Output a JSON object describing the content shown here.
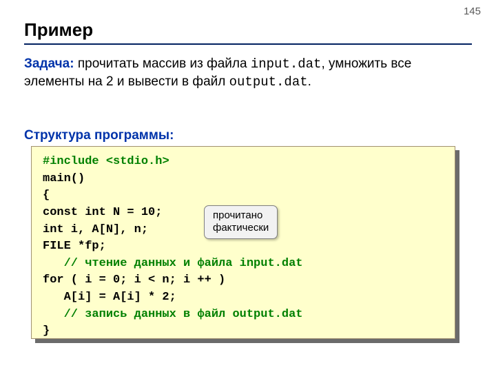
{
  "page_number": "145",
  "title": "Пример",
  "task": {
    "label": "Задача:",
    "text_before_file1": " прочитать массив из файла ",
    "file1": "input.dat",
    "text_mid": ", умножить все элементы на 2 и вывести в файл ",
    "file2": "output.dat",
    "text_after": "."
  },
  "struct_label": "Структура программы:",
  "code": {
    "l1a": "#include ",
    "l1b": "<stdio.h>",
    "l2": "main()",
    "l3": "{",
    "l4": "const int N = 10;",
    "l5": "int i, A[N], n;",
    "l6": "FILE *fp;",
    "l7_indent": "   ",
    "l7_comment": "// чтение данных и файла input.dat",
    "l8": "for ( i = 0; i < n; i ++ )",
    "l9": "   A[i] = A[i] * 2;",
    "l10_indent": "   ",
    "l10_comment": "// запись данных в файл output.dat",
    "l11": "}"
  },
  "callout": {
    "line1": "прочитано",
    "line2": "фактически"
  }
}
